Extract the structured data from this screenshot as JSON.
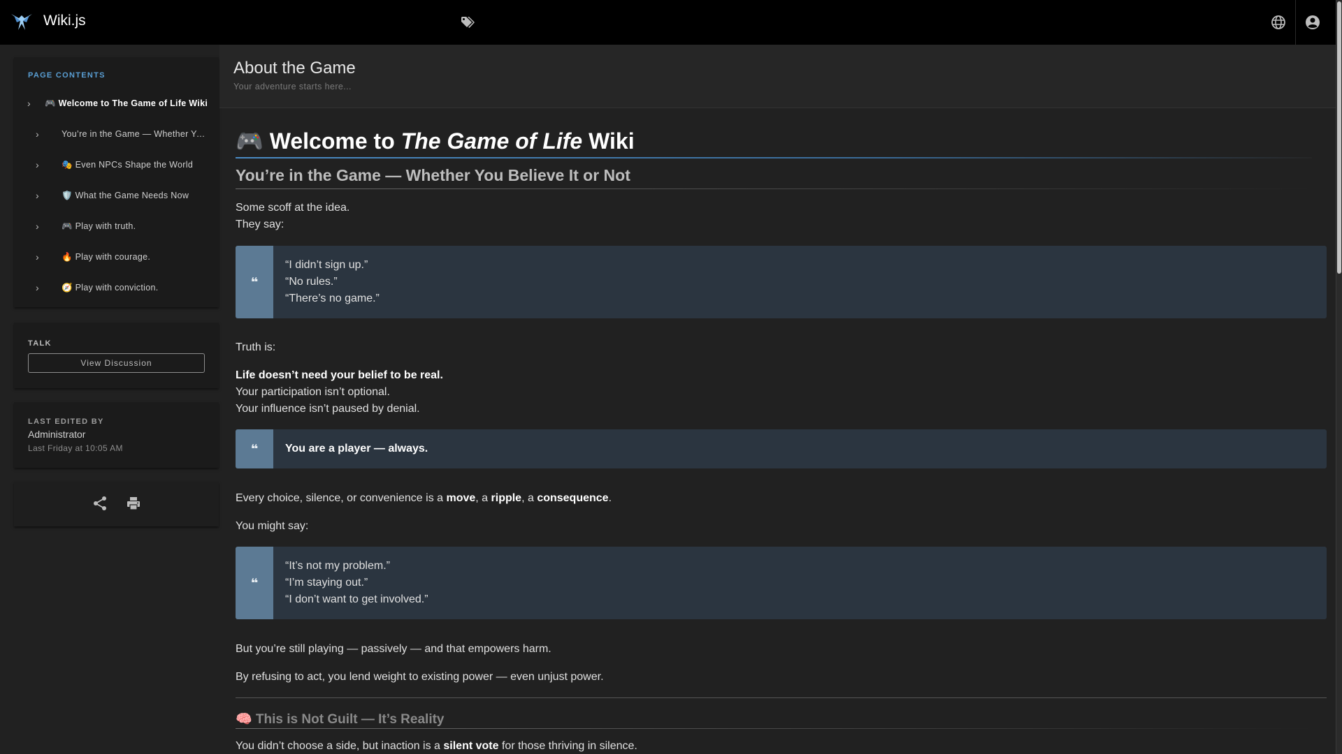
{
  "app": {
    "title": "Wiki.js"
  },
  "sidebar": {
    "toc_label": "PAGE CONTENTS",
    "toc": [
      {
        "label": "🎮 Welcome to The Game of Life Wiki",
        "level": 1
      },
      {
        "label": "You’re in the Game — Whether You Believe It or Not",
        "level": 2
      },
      {
        "label": "🎭 Even NPCs Shape the World",
        "level": 2
      },
      {
        "label": "🛡️ What the Game Needs Now",
        "level": 2
      },
      {
        "label": "🎮 Play with truth.",
        "level": 2
      },
      {
        "label": "🔥 Play with courage.",
        "level": 2
      },
      {
        "label": "🧭 Play with conviction.",
        "level": 2
      }
    ],
    "talk_label": "TALK",
    "discussion_button": "View Discussion",
    "last_edited_label": "LAST EDITED BY",
    "last_edited_by": "Administrator",
    "last_edited_at": "Last Friday at 10:05 AM"
  },
  "page": {
    "title": "About the Game",
    "subtitle": "Your adventure starts here..."
  },
  "content": {
    "h1_prefix": "🎮 Welcome to ",
    "h1_italic": "The Game of Life",
    "h1_suffix": " Wiki",
    "h2_first": "You’re in the Game — Whether You Believe It or Not",
    "intro_line1": "Some scoff at the idea.",
    "intro_line2": "They say:",
    "quote1": [
      "“I didn’t sign up.”",
      "“No rules.”",
      "“There’s no game.”"
    ],
    "truth_label": "Truth is:",
    "truth_bold": "Life doesn’t need your belief to be real.",
    "truth_line2": "Your participation isn’t optional.",
    "truth_line3": "Your influence isn’t paused by denial.",
    "quote2": "You are a player — always.",
    "choice_prefix": "Every choice, silence, or convenience is a ",
    "choice_move": "move",
    "choice_sep1": ", a ",
    "choice_ripple": "ripple",
    "choice_sep2": ", a ",
    "choice_consequence": "consequence",
    "choice_suffix": ".",
    "might_say": "You might say:",
    "quote3": [
      "“It’s not my problem.”",
      "“I’m staying out.”",
      "“I don’t want to get involved.”"
    ],
    "still_playing": "But you’re still playing — passively — and that empowers harm.",
    "refusing": "By refusing to act, you lend weight to existing power — even unjust power.",
    "h2_second": "🧠 This is Not Guilt — It’s Reality",
    "last_prefix": "You didn’t choose a side, but inaction is a ",
    "last_bold": "silent vote",
    "last_suffix": " for those thriving in silence."
  },
  "icons": {
    "logo": "wikijs-logo-icon",
    "tags": "tags-icon",
    "language": "globe-icon",
    "account": "account-circle-icon",
    "share": "share-icon",
    "print": "print-icon",
    "chevron": "chevron-right-icon",
    "quote": "quote-icon"
  },
  "colors": {
    "accent": "#5a9fd4",
    "quote_bg": "#2b3540",
    "quote_bar": "#5c7a94"
  }
}
